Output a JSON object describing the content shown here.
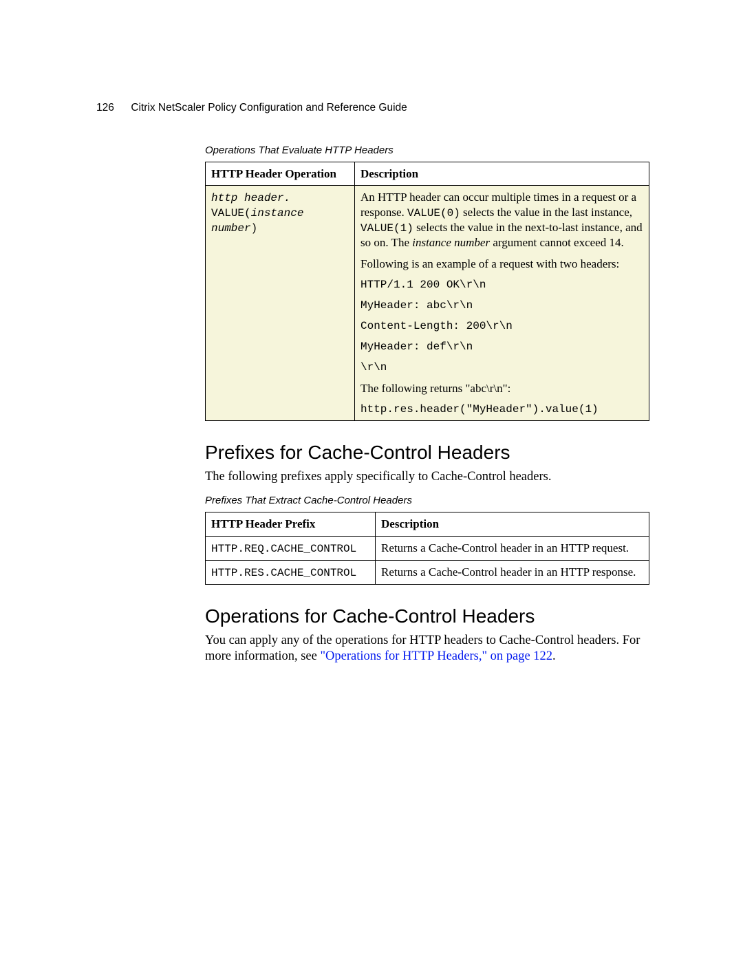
{
  "header": {
    "page_number": "126",
    "title": "Citrix NetScaler Policy Configuration and Reference Guide"
  },
  "table1": {
    "caption": "Operations That Evaluate HTTP Headers",
    "col1_header": "HTTP Header Operation",
    "col2_header": "Description",
    "row": {
      "op_line1": "http header.",
      "op_line2_a": "VALUE(",
      "op_line2_b": "instance number",
      "op_line2_c": ")",
      "d_p1_a": "An HTTP header can occur multiple times in a request or a response. ",
      "d_p1_code1": "VALUE(0)",
      "d_p1_b": " selects the value in the last instance, ",
      "d_p1_code2": "VALUE(1)",
      "d_p1_c": " selects the value in the next-to-last instance, and so on. The ",
      "d_p1_it": "instance number",
      "d_p1_d": " argument cannot exceed 14.",
      "d_p2": "Following is an example of a request with two headers:",
      "d_c1": "HTTP/1.1 200 OK\\r\\n",
      "d_c2": "MyHeader: abc\\r\\n",
      "d_c3": "Content-Length: 200\\r\\n",
      "d_c4": "MyHeader: def\\r\\n",
      "d_c5": "\\r\\n",
      "d_p3": "The following returns \"abc\\r\\n\":",
      "d_c6": "http.res.header(\"MyHeader\").value(1)"
    }
  },
  "section1": {
    "heading": "Prefixes for Cache-Control Headers",
    "intro": "The following prefixes apply specifically to Cache-Control headers."
  },
  "table2": {
    "caption": "Prefixes That Extract Cache-Control Headers",
    "col1_header": "HTTP Header Prefix",
    "col2_header": "Description",
    "rows": [
      {
        "prefix": "HTTP.REQ.CACHE_CONTROL",
        "desc": "Returns a Cache-Control header in an HTTP request."
      },
      {
        "prefix": "HTTP.RES.CACHE_CONTROL",
        "desc": "Returns a Cache-Control header in an HTTP response."
      }
    ]
  },
  "section2": {
    "heading": "Operations for Cache-Control Headers",
    "p_a": "You can apply any of the operations for HTTP headers to Cache-Control headers. For more information, see ",
    "link": "\"Operations for HTTP Headers,\" on page 122",
    "p_b": "."
  }
}
